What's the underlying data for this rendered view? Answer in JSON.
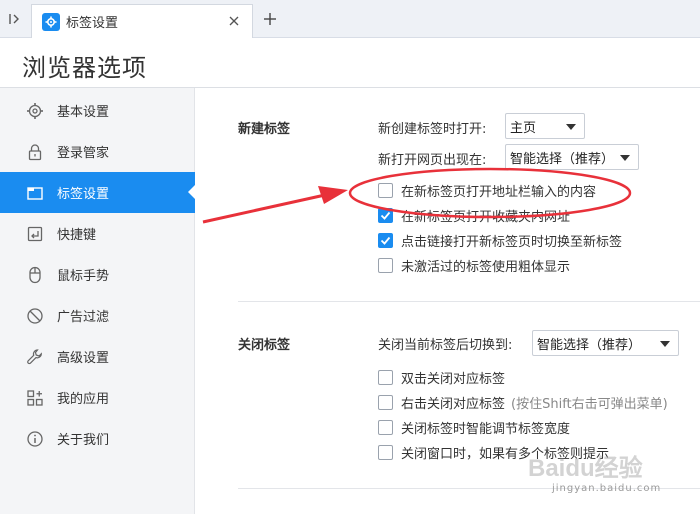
{
  "tab": {
    "title": "标签设置"
  },
  "page": {
    "title": "浏览器选项"
  },
  "sidebar": {
    "items": [
      {
        "label": "基本设置",
        "icon": "gear-icon"
      },
      {
        "label": "登录管家",
        "icon": "lock-icon"
      },
      {
        "label": "标签设置",
        "icon": "tab-icon",
        "active": true
      },
      {
        "label": "快捷键",
        "icon": "keyboard-icon"
      },
      {
        "label": "鼠标手势",
        "icon": "mouse-icon"
      },
      {
        "label": "广告过滤",
        "icon": "block-icon"
      },
      {
        "label": "高级设置",
        "icon": "wrench-icon"
      },
      {
        "label": "我的应用",
        "icon": "apps-icon"
      },
      {
        "label": "关于我们",
        "icon": "info-icon"
      }
    ]
  },
  "new_tab": {
    "title": "新建标签",
    "open_label": "新创建标签时打开:",
    "open_value": "主页",
    "webpage_label": "新打开网页出现在:",
    "webpage_value": "智能选择（推荐）",
    "options": [
      {
        "label": "在新标签页打开地址栏输入的内容",
        "checked": false
      },
      {
        "label": "在新标签页打开收藏夹内网址",
        "checked": true
      },
      {
        "label": "点击链接打开新标签页时切换至新标签",
        "checked": true
      },
      {
        "label": "未激活过的标签使用粗体显示",
        "checked": false
      }
    ]
  },
  "close_tab": {
    "title": "关闭标签",
    "switch_label": "关闭当前标签后切换到:",
    "switch_value": "智能选择（推荐）",
    "options": [
      {
        "label": "双击关闭对应标签",
        "checked": false
      },
      {
        "label": "右击关闭对应标签",
        "hint": "(按住Shift右击可弹出菜单)",
        "checked": false
      },
      {
        "label": "关闭标签时智能调节标签宽度",
        "checked": false
      },
      {
        "label": "关闭窗口时，如果有多个标签则提示",
        "checked": false
      }
    ]
  },
  "watermark": {
    "text": "Baidu经验",
    "sub": "jingyan.baidu.com"
  },
  "colors": {
    "accent": "#1a8cf0",
    "annotation": "#e8313a"
  }
}
